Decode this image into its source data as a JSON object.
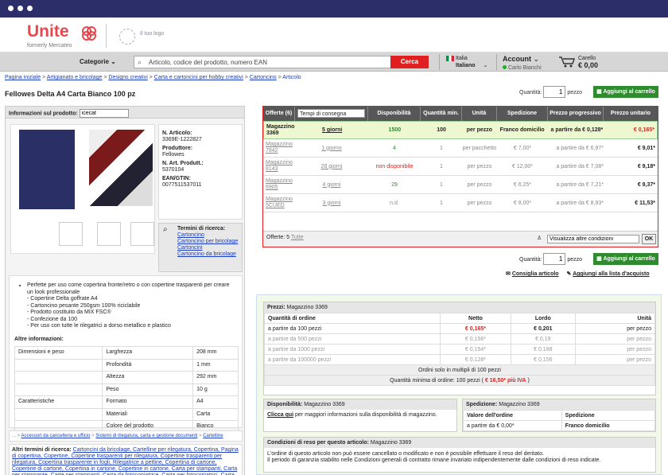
{
  "header": {
    "logo": "Unite",
    "logo_sub": "formerly Mercateo",
    "tuo_logo": "Il tuo logo"
  },
  "nav": {
    "categories": "Categorie",
    "search_placeholder": "Articolo, codice del prodotto, numero EAN",
    "search_button": "Cerca",
    "country": "Italia",
    "language": "Italiano",
    "account": "Account",
    "account_name": "Carlo Bianchi",
    "cart_label": "Carello",
    "cart_total": "€ 0,00"
  },
  "breadcrumb": [
    "Pagina iniziale",
    "Artigianato e bricolage",
    "Designs creativi",
    "Carta e cartoncini per hobby creativi",
    "Cartoncino",
    "Articolo"
  ],
  "product": {
    "title": "Fellowes Delta A4 Carta Bianco 100 pz",
    "quantity_label": "Quantità:",
    "quantity": "1",
    "unit": "pezzo",
    "add_to_cart": "Aggiungi al carrello",
    "info_label": "Informazioni sul prodotto:",
    "info_input": "icecat",
    "article_no_label": "N. Articolo:",
    "article_no": "3369E-1222827",
    "producer_label": "Produttore:",
    "producer": "Fellowes",
    "mfr_no_label": "N. Art. Produtt.:",
    "mfr_no": "5370104",
    "ean_label": "EAN/GTIN:",
    "ean": "0077511537011",
    "search_terms_label": "Termini di ricerca:",
    "search_terms": [
      "Cartoncino",
      "Cartoncino per bricolage",
      "Cartoncini",
      "Cartoncino da bricolage"
    ],
    "bullets": [
      "Perfette per uso come copertina fronte/retro o con copertine trasparenti per creare un look professionale",
      "- Copertine Delta goffrate A4",
      "- Cartoncino pesante 250gsm 100% riciclabile",
      "- Prodotto costituito da MIX FSC®",
      "- Confezione da 100",
      "- Per uso con tutte le rilegatrici a dorso metallico e plastico"
    ],
    "other_info": "Altre informazioni:",
    "attributes": [
      {
        "group": "Dimensioni e peso",
        "name": "Larghezza",
        "value": "208 mm"
      },
      {
        "group": "",
        "name": "Profondità",
        "value": "1 mm"
      },
      {
        "group": "",
        "name": "Altezza",
        "value": "292 mm"
      },
      {
        "group": "",
        "name": "Peso",
        "value": "10 g"
      },
      {
        "group": "Caratteristiche",
        "name": "Formato",
        "value": "A4"
      },
      {
        "group": "",
        "name": "Materiali",
        "value": "Carta"
      },
      {
        "group": "",
        "name": "Colore del prodotto",
        "value": "Bianco"
      }
    ],
    "crumb2_prefix": "... >",
    "crumb2": [
      "Accessori da cancelleria e ufficio",
      "Sistemi di rilegatura, carta e gestione documenti",
      "Cartelline"
    ],
    "other_terms_label": "Altri termini di ricerca:",
    "other_terms": "Cartoncini da bricolage, Cartelline per rilegatura, Copertina, Pagina di copertina, Copertine, Copertine trasparenti per rilegatura, Copertine trasparenti per rilegatura, Copertina trasparente in fogli, Rilegatrice a pettine, Copertina di cartone, Copertine di cartone, Copertina in cartone, Copertine in cartone, Carta per stampanti, Carta per stampante, Carte per stampanti, Carta da fotocopiatrice, Carta per fotocopiatrici, Carta per fotocopiatrici, Carta da fotocopie, Carta da fotocopia, Carta da"
  },
  "offers": {
    "headers": [
      "Offerte (6)",
      "",
      "Disponibilità",
      "Quantità min.",
      "Unità",
      "Spedizione",
      "Prezzo progressivo",
      "Prezzo unitario"
    ],
    "sort": "Tempi di consegna",
    "rows": [
      {
        "seller": "Magazzino 3369",
        "time": "5 giorni",
        "avail": "1500",
        "min": "100",
        "unit": "per pezzo",
        "ship": "Franco domicilio",
        "prog": "a partire da € 0,128*",
        "price": "€ 0,165*"
      },
      {
        "seller": "Magazzino 7842",
        "time": "1 giorno",
        "avail": "4",
        "min": "1",
        "unit": "per pacchetto",
        "ship": "€ 7,00*",
        "prog": "a partire da € 6,97*",
        "price": "€ 9,01*"
      },
      {
        "seller": "Magazzino 8143",
        "time": "28 giorni",
        "avail": "non disponibile",
        "min": "1",
        "unit": "per pezzo",
        "ship": "€ 12,00*",
        "prog": "a partire da € 7,08*",
        "price": "€ 9,18*"
      },
      {
        "seller": "Magazzino 6905",
        "time": "4 giorni",
        "avail": "29",
        "min": "1",
        "unit": "per pezzo",
        "ship": "€ 6,25*",
        "prog": "a partire da € 7,21*",
        "price": "€ 9,37*"
      },
      {
        "seller": "Magazzino 5CUED",
        "time": "3 giorni",
        "avail": "n.d.",
        "min": "1",
        "unit": "per pezzo",
        "ship": "€ 8,00*",
        "prog": "a partire da € 8,93*",
        "price": "€ 11,53*"
      }
    ],
    "footer_label": "Offerte:",
    "footer_count": "5",
    "footer_all": "Tutte",
    "other_conditions": "Visualizza altre condizioni",
    "ok": "OK"
  },
  "actions": {
    "compare": "Consiglia articolo",
    "wishlist": "Aggiungi alla lista d'acquisto"
  },
  "prices": {
    "title": "Prezzi:",
    "seller": "Magazzino 3369",
    "cols": [
      "Quantità di ordine",
      "Netto",
      "Lordo",
      "Unità"
    ],
    "rows": [
      [
        "a partire da 100 pezzi",
        "€ 0,165*",
        "€ 0,201",
        "per pezzo"
      ],
      [
        "a partire da 500 pezzi",
        "€ 0,156*",
        "€ 0,19",
        "per pezzo"
      ],
      [
        "a partire da 1000 pezzi",
        "€ 0,154*",
        "€ 0,188",
        "per pezzo"
      ],
      [
        "a partire da 100000 pezzi",
        "€ 0,128*",
        "€ 0,156",
        "per pezzo"
      ]
    ],
    "multiples": "Ordini solo in multipli di 100 pezzi",
    "min_order": "Quantità minima di ordine: 100 pezzi (",
    "min_order_value": "€ 16,50* più IVA",
    "min_order_end": ")"
  },
  "availability": {
    "title": "Disponibilità:",
    "seller": "Magazzino 3369",
    "link": "Clicca qui",
    "text": "per maggiori informazioni sulla disponibilità di magazzino."
  },
  "shipping": {
    "title": "Spedizione:",
    "seller": "Magazzino 3369",
    "col1": "Valore dell'ordine",
    "col2": "Spedizione",
    "val1": "a partire da € 0,00*",
    "val2": "Franco domicilio"
  },
  "returns": {
    "title": "Condizioni di reso per questo articolo:",
    "seller": "Magazzino 3369",
    "line1": "L'ordine di questo articolo non può essere cancellato o modificato e non è possibile effettuare il reso del deritato.",
    "line2": "Il periodo di garanzia stabilito nelle Condizioni generali di contratto rimane invariato indipendentemente dalle condizioni di reso indicate."
  },
  "colors": {
    "brand": "#e9474f",
    "accent": "#2e8b2e",
    "alert": "#e02020",
    "frame": "#2b2e68"
  }
}
